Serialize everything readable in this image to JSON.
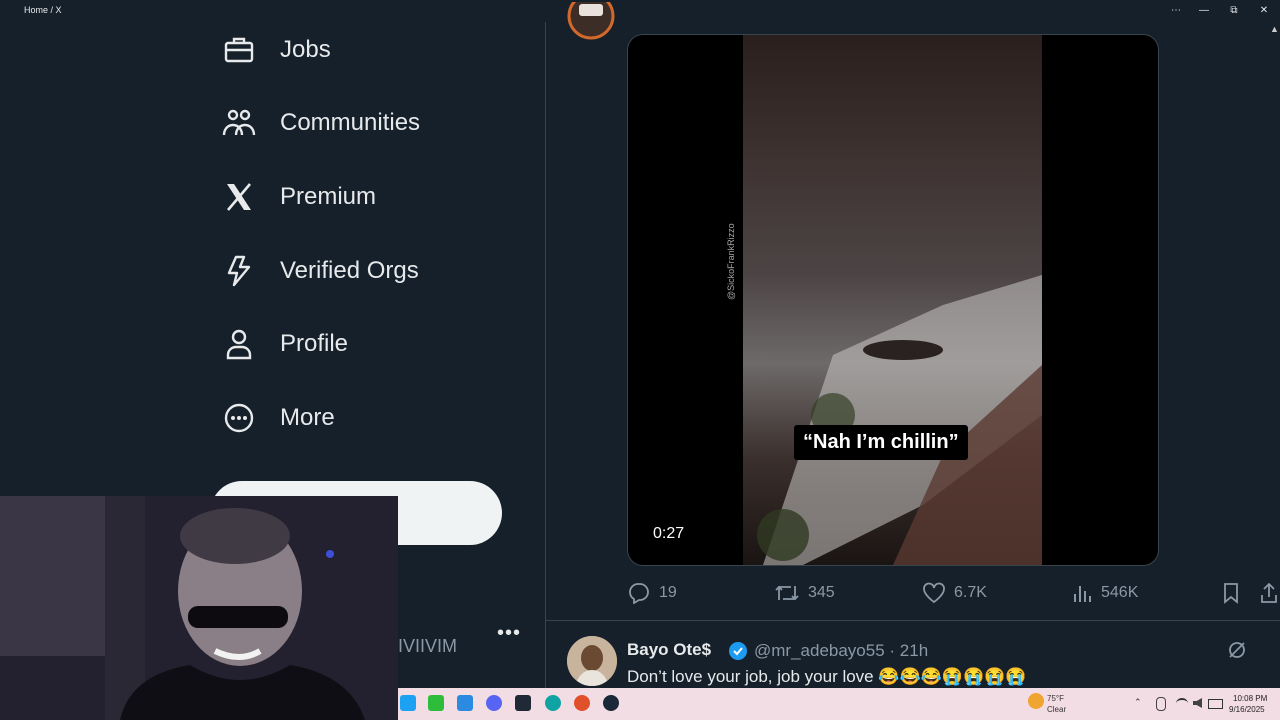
{
  "window": {
    "title": "Home / X",
    "controls": [
      "⋯",
      "—",
      "⧉",
      "✕"
    ]
  },
  "sidebar": {
    "items": [
      {
        "label": "Jobs",
        "icon": "briefcase-icon"
      },
      {
        "label": "Communities",
        "icon": "communities-icon"
      },
      {
        "label": "Premium",
        "icon": "x-logo-icon"
      },
      {
        "label": "Verified Orgs",
        "icon": "lightning-icon"
      },
      {
        "label": "Profile",
        "icon": "person-icon"
      },
      {
        "label": "More",
        "icon": "more-circle-icon"
      }
    ],
    "account_handle_fragment": "IVIIVIM",
    "account_more": "•••"
  },
  "tweet": {
    "video": {
      "caption": "“Nah I’m chillin”",
      "watermark": "@SickoFrankRizzo",
      "duration": "0:27"
    },
    "actions": {
      "replies": "19",
      "reposts": "345",
      "likes": "6.7K",
      "views": "546K"
    }
  },
  "next_tweet": {
    "name": "Bayo Ote$",
    "handle_time": "@mr_adebayo55 · 21h",
    "text": "Don’t love your job, job your love 😂😂😂😭😭😭😭"
  },
  "taskbar": {
    "weather_temp": "75°F",
    "weather_condition": "Clear",
    "time": "10:08 PM",
    "date": "9/16/2025"
  },
  "colors": {
    "background": "#15202b",
    "text": "#e7e9ea",
    "muted": "#8b98a5",
    "verified": "#1d9bf0",
    "taskbar": "#f3dde4"
  }
}
